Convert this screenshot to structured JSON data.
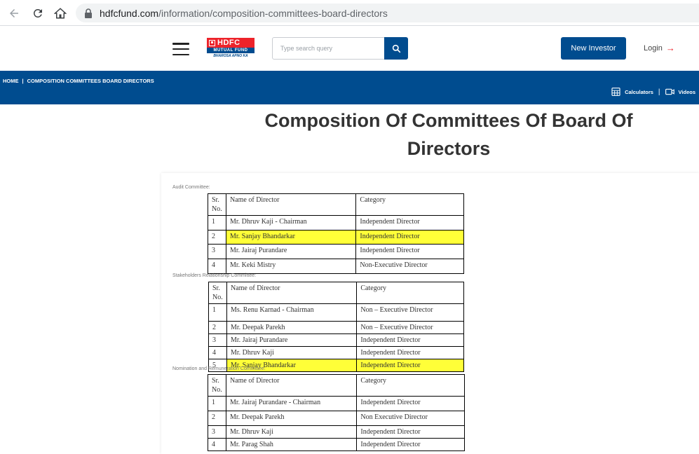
{
  "browser": {
    "url_host": "hdfcfund.com",
    "url_path": "/information/composition-committees-board-directors"
  },
  "header": {
    "logo_line1": "HDFC",
    "logo_line2": "MUTUAL FUND",
    "logo_tagline": "BHAROSA APNO KA",
    "search_placeholder": "Type search query",
    "new_investor_label": "New Investor",
    "login_label": "Login",
    "login_arrow": "→"
  },
  "breadcrumb": {
    "home": "HOME",
    "separator": "|",
    "current": "COMPOSITION COMMITTEES BOARD DIRECTORS"
  },
  "tools": {
    "calculators": "Calculators",
    "separator": "|",
    "videos": "Videos"
  },
  "page": {
    "title_line1": "Composition Of Committees Of Board Of",
    "title_line2": "Directors"
  },
  "colors": {
    "brand_blue": "#004c8f",
    "brand_red": "#ed232a",
    "highlight": "#ffff38"
  },
  "committees": [
    {
      "label": "Audit Committee:",
      "headers": {
        "sr": "Sr. No.",
        "name": "Name of Director",
        "category": "Category"
      },
      "rows": [
        {
          "sr": "1",
          "name": "Mr. Dhruv Kaji - Chairman",
          "category": "Independent Director"
        },
        {
          "sr": "2",
          "name": "Mr. Sanjay Bhandarkar",
          "category": "Independent Director"
        },
        {
          "sr": "3",
          "name": "Mr. Jairaj Purandare",
          "category": "Independent Director"
        },
        {
          "sr": "4",
          "name": "Mr. Keki Mistry",
          "category": "Non-Executive Director"
        }
      ]
    },
    {
      "label": "Stakeholders Relationship Committee:",
      "headers": {
        "sr": "Sr. No.",
        "name": "Name of Director",
        "category": "Category"
      },
      "rows": [
        {
          "sr": "1",
          "name": "Ms. Renu Karnad - Chairman",
          "category": "Non – Executive Director"
        },
        {
          "sr": "2",
          "name": "Mr. Deepak Parekh",
          "category": "Non – Executive Director"
        },
        {
          "sr": "3",
          "name": "Mr. Jairaj Purandare",
          "category": "Independent Director"
        },
        {
          "sr": "4",
          "name": "Mr. Dhruv Kaji",
          "category": "Independent Director"
        },
        {
          "sr": "5",
          "name": "Mr. Sanjay Bhandarkar",
          "category": "Independent Director"
        }
      ]
    },
    {
      "label": "Nomination and Remuneration Committee:",
      "headers": {
        "sr": "Sr. No.",
        "name": "Name of Director",
        "category": "Category"
      },
      "rows": [
        {
          "sr": "1",
          "name": "Mr. Jairaj Purandare - Chairman",
          "category": "Independent Director"
        },
        {
          "sr": "2",
          "name": "Mr. Deepak Parekh",
          "category": "Non Executive Director"
        },
        {
          "sr": "3",
          "name": "Mr. Dhruv Kaji",
          "category": "Independent Director"
        },
        {
          "sr": "4",
          "name": "Mr. Parag Shah",
          "category": "Independent Director"
        }
      ]
    }
  ]
}
